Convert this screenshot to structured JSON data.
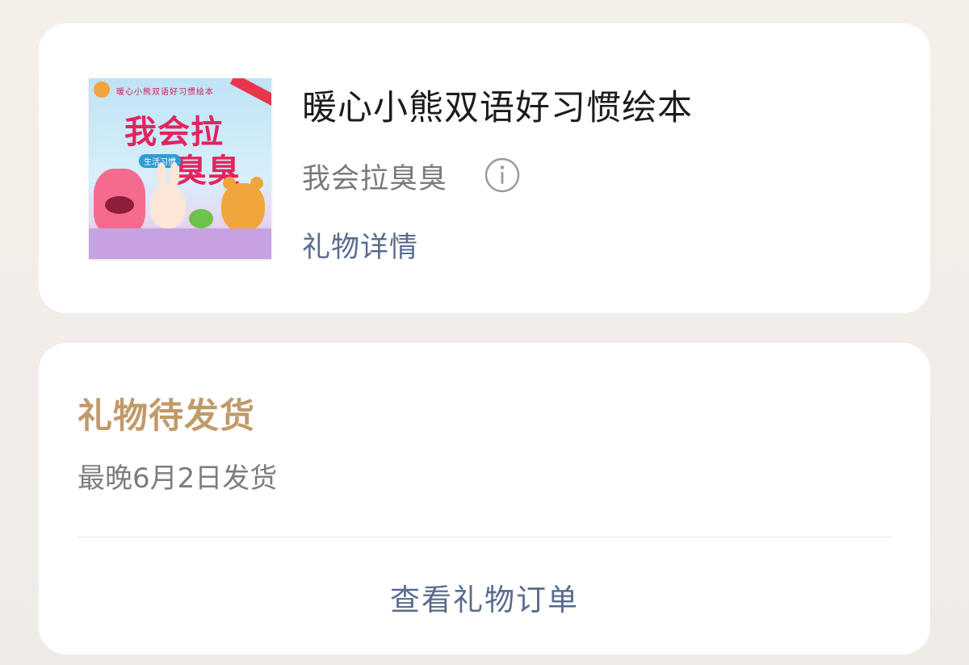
{
  "gift": {
    "cover": {
      "series_text": "暖心小熊双语好习惯绘本",
      "title_line1": "我会拉",
      "title_line2": "臭臭",
      "tag_text": "生活习惯"
    },
    "title": "暖心小熊双语好习惯绘本",
    "subtitle": "我会拉臭臭",
    "info_icon": "info-circle-icon",
    "detail_link": "礼物详情"
  },
  "status": {
    "title": "礼物待发货",
    "subtitle": "最晚6月2日发货",
    "order_link": "查看礼物订单"
  },
  "colors": {
    "status_title": "#c19a6a",
    "link": "#586c8e",
    "cover_title": "#e3245e"
  }
}
